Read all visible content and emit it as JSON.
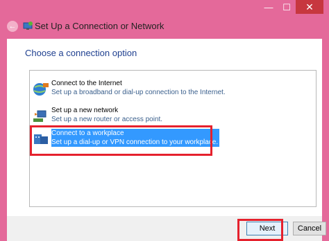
{
  "window": {
    "title": "Set Up a Connection or Network",
    "controls": {
      "minimize": "—",
      "maximize": "☐",
      "close": "✕"
    }
  },
  "dialog": {
    "heading": "Choose a connection option",
    "options": [
      {
        "title": "Connect to the Internet",
        "description": "Set up a broadband or dial-up connection to the Internet.",
        "icon": "globe-network-icon",
        "selected": false
      },
      {
        "title": "Set up a new network",
        "description": "Set up a new router or access point.",
        "icon": "router-icon",
        "selected": false
      },
      {
        "title": "Connect to a workplace",
        "description": "Set up a dial-up or VPN connection to your workplace.",
        "icon": "workplace-icon",
        "selected": true
      }
    ]
  },
  "footer": {
    "next_label": "Next",
    "cancel_label": "Cancel"
  },
  "colors": {
    "accent": "#e4699a",
    "selection": "#3399ff",
    "annotation": "#e5212d",
    "heading": "#1e3f8f"
  }
}
